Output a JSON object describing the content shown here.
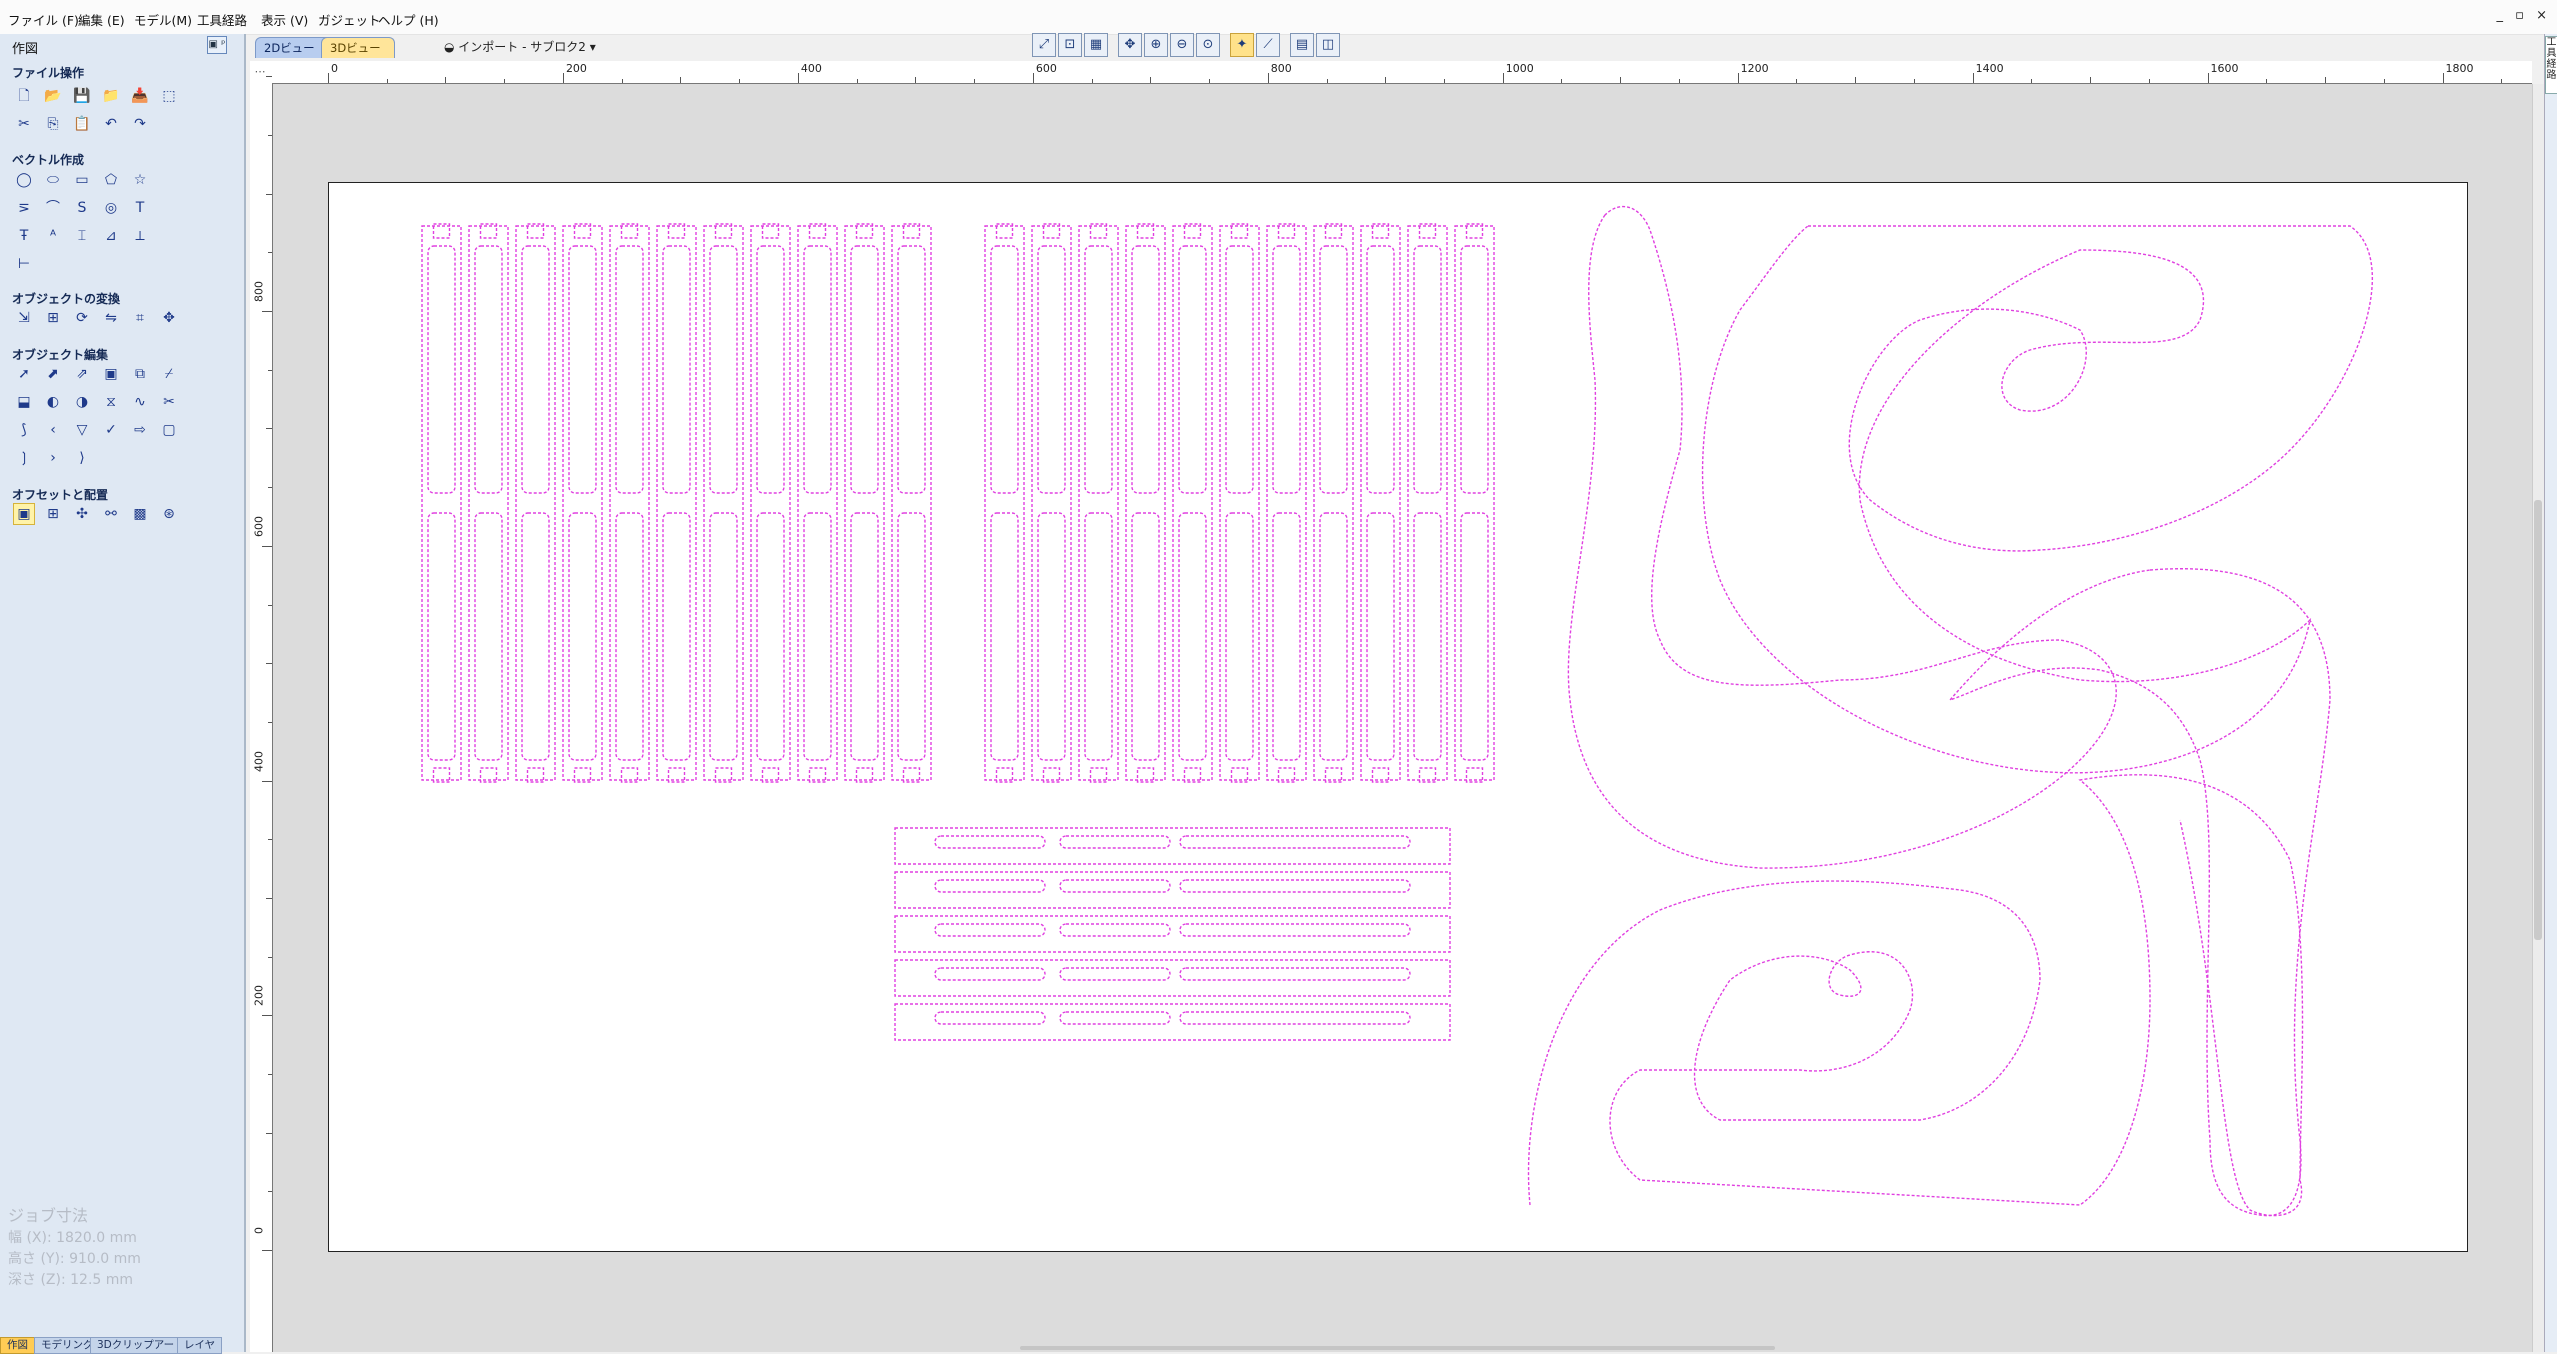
{
  "menu": [
    "ファイル (F)",
    "編集 (E)",
    "モデル(M)",
    "工具経路",
    "表示 (V)",
    "ガジェット",
    "ヘルプ (H)"
  ],
  "window_controls": "_ ▫ ×",
  "panel": {
    "title": "作図",
    "pin": "▣ ᵖ",
    "sections": {
      "file": "ファイル操作",
      "vector": "ベクトル作成",
      "transform": "オブジェクトの変換",
      "edit": "オブジェクト編集",
      "offset": "オフセットと配置"
    }
  },
  "job": {
    "title": "ジョブ寸法",
    "width": "幅  (X): 1820.0 mm",
    "height": "高さ (Y): 910.0 mm",
    "depth": "深さ (Z): 12.5 mm"
  },
  "bottom_tabs": [
    "作図",
    "モデリング",
    "3Dクリップアート",
    "レイヤ"
  ],
  "view_tabs": {
    "two_d": "2Dビュー",
    "three_d": "3Dビュー"
  },
  "import_label": "インポート - サブロク2",
  "right_tab": "工具経路",
  "ruler": {
    "h_labels": [
      "0",
      "200",
      "400",
      "600",
      "800",
      "1000",
      "1200",
      "1400",
      "1600",
      "1800"
    ],
    "v_labels": [
      "800",
      "600",
      "400",
      "200",
      "0"
    ]
  },
  "colors": {
    "vector": "#e040e0",
    "panel": "#dfe8f3",
    "highlight": "#fff3a8"
  },
  "icons": {
    "file_ops": [
      "new-file-icon",
      "open-file-icon",
      "save-icon",
      "import-icon",
      "import-vector-icon",
      "select-all-icon",
      "cut-icon",
      "copy-icon",
      "paste-icon",
      "undo-icon",
      "redo-icon"
    ],
    "vector_create": [
      "circle-icon",
      "ellipse-icon",
      "rectangle-icon",
      "polygon-icon",
      "star-icon",
      "polyline-icon",
      "arc-icon",
      "curve-icon",
      "spiral-icon",
      "text-icon",
      "text-on-curve-icon",
      "text-style-icon",
      "dimension-icon",
      "leader-icon",
      "measure-icon",
      "guide-icon"
    ],
    "transform": [
      "move-icon",
      "scale-icon",
      "rotate-icon",
      "mirror-icon",
      "align-icon",
      "distort-icon"
    ],
    "edit": [
      "select-icon",
      "node-edit-icon",
      "interactive-select-icon",
      "group-icon",
      "ungroup-icon",
      "trim-icon",
      "weld-icon",
      "subtract-icon",
      "intersect-icon",
      "join-icon",
      "curve-fit-icon",
      "scissors-icon",
      "smooth-icon",
      "left-chevron-icon",
      "fillet-icon",
      "check-icon",
      "arrow-icon",
      "round-rect-icon",
      "bracket-icon",
      "chevron-icon",
      "extend-icon"
    ],
    "offset": [
      "offset-icon",
      "array-icon",
      "rotate-copy-icon",
      "nest-icon",
      "block-copy-icon",
      "circle-copy-icon"
    ]
  }
}
